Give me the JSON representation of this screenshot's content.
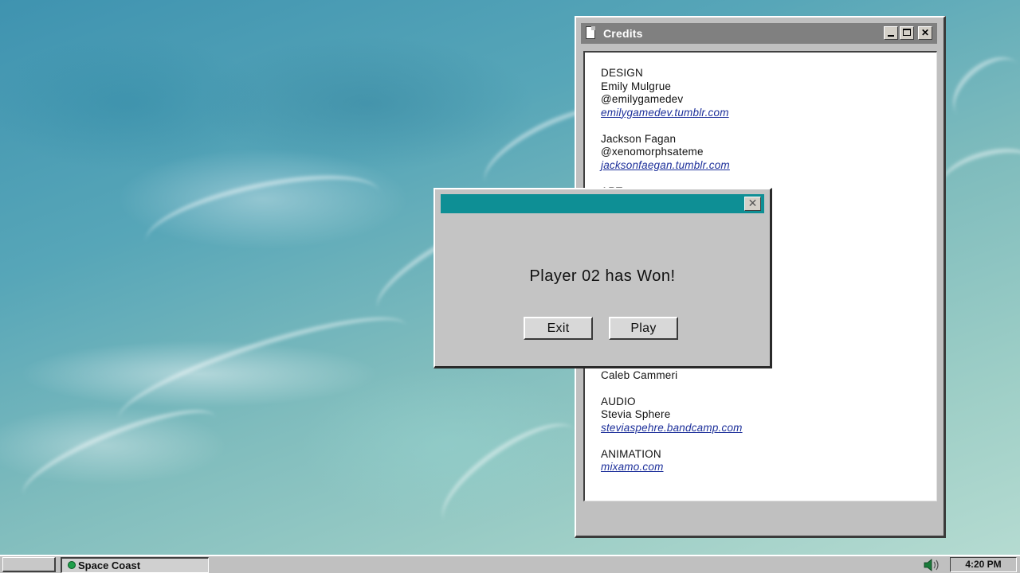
{
  "credits_window": {
    "title": "Credits",
    "lines": [
      {
        "text": "DESIGN",
        "type": "heading"
      },
      {
        "text": "Emily Mulgrue",
        "type": "text"
      },
      {
        "text": "@emilygamedev",
        "type": "text"
      },
      {
        "text": "emilygamedev.tumblr.com",
        "type": "link"
      },
      {
        "text": "",
        "type": "gap"
      },
      {
        "text": "Jackson Fagan",
        "type": "text"
      },
      {
        "text": "@xenomorphsateme",
        "type": "text"
      },
      {
        "text": "jacksonfaegan.tumblr.com",
        "type": "link"
      },
      {
        "text": "",
        "type": "gap"
      },
      {
        "text": "ART",
        "type": "heading"
      },
      {
        "text": "",
        "type": "hidden"
      },
      {
        "text": "",
        "type": "hidden"
      },
      {
        "text": "",
        "type": "hidden"
      },
      {
        "text": "",
        "type": "hidden"
      },
      {
        "text": "",
        "type": "hidden"
      },
      {
        "text": "",
        "type": "hidden"
      },
      {
        "text": "",
        "type": "hidden"
      },
      {
        "text": "",
        "type": "hidden"
      },
      {
        "text": "",
        "type": "hidden"
      },
      {
        "text": "",
        "type": "hidden"
      },
      {
        "text": "",
        "type": "hidden"
      },
      {
        "text": "",
        "type": "hidden"
      },
      {
        "text": "",
        "type": "hidden"
      },
      {
        "text": "Caleb Cammeri",
        "type": "text"
      },
      {
        "text": "",
        "type": "gap"
      },
      {
        "text": "AUDIO",
        "type": "heading"
      },
      {
        "text": "Stevia Sphere",
        "type": "text"
      },
      {
        "text": "steviaspehre.bandcamp.com",
        "type": "link"
      },
      {
        "text": "",
        "type": "gap"
      },
      {
        "text": "ANIMATION",
        "type": "heading"
      },
      {
        "text": "mixamo.com",
        "type": "link"
      }
    ]
  },
  "dialog": {
    "message": "Player 02 has Won!",
    "exit_label": "Exit",
    "play_label": "Play"
  },
  "taskbar": {
    "task_label": "Space Coast",
    "clock": "4:20 PM"
  },
  "colors": {
    "dialog_titlebar": "#0e8f95",
    "window_titlebar": "#808080",
    "link": "#1c2f9a"
  }
}
